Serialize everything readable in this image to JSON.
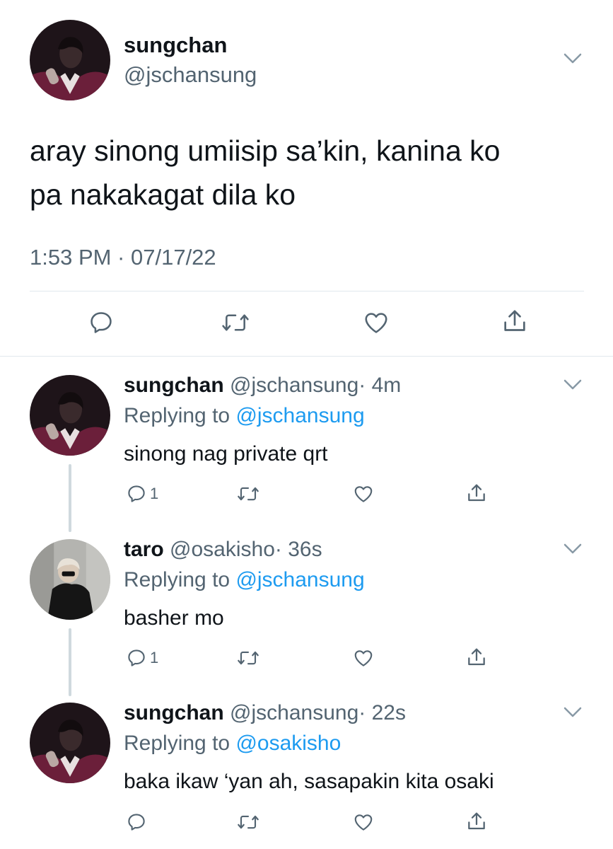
{
  "main_tweet": {
    "display_name": "sungchan",
    "handle": "@jschansung",
    "text_line1": "aray sinong umiisip sa’kin, kanina ko",
    "text_line2": "pa nakakagat dila ko",
    "timestamp": "1:53 PM · 07/17/22",
    "actions": [
      "reply-icon",
      "retweet-icon",
      "like-icon",
      "share-icon"
    ]
  },
  "replies": [
    {
      "display_name": "sungchan",
      "handle": "@jschansung",
      "time": "· 4m",
      "replying_label": "Replying to ",
      "replying_to": "@jschansung",
      "text": "sinong nag private qrt",
      "reply_count": "1"
    },
    {
      "display_name": "taro",
      "handle": "@osakisho",
      "time": "· 36s",
      "replying_label": "Replying to ",
      "replying_to": "@jschansung",
      "text": "basher mo",
      "reply_count": "1"
    },
    {
      "display_name": "sungchan",
      "handle": "@jschansung",
      "time": "· 22s",
      "replying_label": "Replying to ",
      "replying_to": "@osakisho",
      "text": "baka ikaw ‘yan ah, sasapakin kita osaki",
      "reply_count": ""
    }
  ],
  "colors": {
    "primary_text": "#0f1419",
    "secondary_text": "#536471",
    "mention": "#1d9bf0",
    "divider": "#e1e8ed",
    "thread_line": "#cfd9de"
  }
}
